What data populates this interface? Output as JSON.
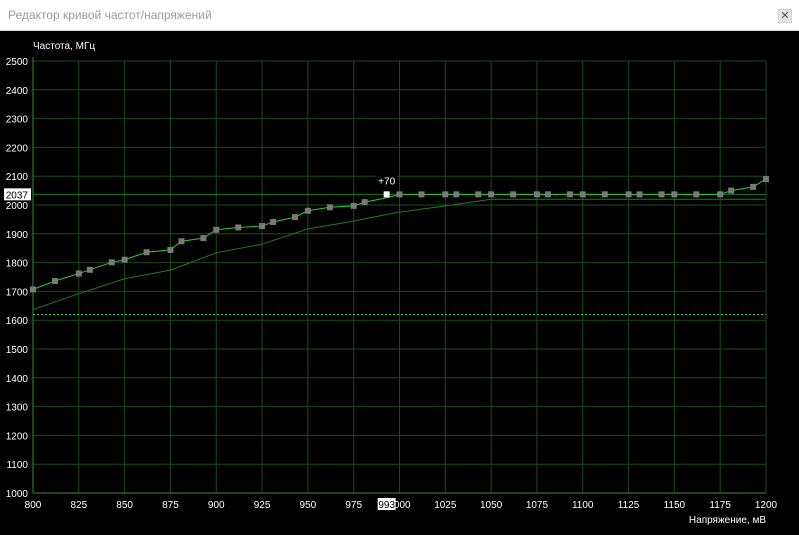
{
  "window": {
    "title": "Редактор кривой частот/напряжений",
    "close_glyph": "✕"
  },
  "chart_data": {
    "type": "line",
    "ylabel": "Частота, МГц",
    "xlabel": "Напряжение, мВ",
    "xlim": [
      800,
      1200
    ],
    "ylim": [
      1000,
      2500
    ],
    "xticks": [
      800,
      825,
      850,
      875,
      900,
      925,
      950,
      975,
      1000,
      1025,
      1050,
      1075,
      1100,
      1125,
      1150,
      1175,
      1200
    ],
    "yticks": [
      1000,
      1100,
      1200,
      1300,
      1400,
      1500,
      1600,
      1700,
      1800,
      1900,
      2000,
      2100,
      2200,
      2300,
      2400,
      2500
    ],
    "grid": true,
    "colors": {
      "background": "#000000",
      "grid": "#1c4a1c",
      "axis": "#3a8a3a",
      "curve": "#2ecc2e",
      "baseline_curve": "#1f7a1f",
      "reference_line": "#33cc33",
      "point": "#7a7a7a",
      "selected_point": "#ffffff",
      "label_text": "#ffffff"
    },
    "series": [
      {
        "role": "curve",
        "x": [
          800,
          812,
          825,
          831,
          843,
          850,
          862,
          875,
          881,
          893,
          900,
          912,
          925,
          931,
          943,
          950,
          962,
          975,
          981,
          993,
          1000,
          1012,
          1025,
          1031,
          1043,
          1050,
          1062,
          1075,
          1081,
          1093,
          1100,
          1112,
          1125,
          1131,
          1143,
          1150,
          1162,
          1175,
          1181,
          1193,
          1200
        ],
        "y": [
          1707,
          1736,
          1762,
          1775,
          1801,
          1810,
          1836,
          1844,
          1874,
          1885,
          1914,
          1922,
          1927,
          1941,
          1958,
          1980,
          1992,
          1997,
          2010,
          2025,
          2037,
          2037,
          2037,
          2037,
          2037,
          2037,
          2037,
          2037,
          2037,
          2037,
          2037,
          2037,
          2037,
          2037,
          2037,
          2037,
          2037,
          2037,
          2050,
          2063,
          2090
        ],
        "markers": [
          true,
          true,
          true,
          true,
          true,
          true,
          true,
          true,
          true,
          true,
          true,
          true,
          true,
          true,
          true,
          true,
          true,
          true,
          true,
          false,
          true,
          true,
          true,
          true,
          true,
          true,
          true,
          true,
          true,
          true,
          true,
          true,
          true,
          true,
          true,
          true,
          true,
          true,
          true,
          true,
          true
        ]
      },
      {
        "role": "baseline_curve",
        "x": [
          800,
          825,
          850,
          875,
          900,
          925,
          950,
          975,
          993,
          1000,
          1025,
          1050,
          1075,
          1100,
          1125,
          1150,
          1175,
          1200
        ],
        "y": [
          1637,
          1692,
          1744,
          1774,
          1834,
          1864,
          1917,
          1944,
          1967,
          1975,
          1997,
          2020,
          2020,
          2020,
          2020,
          2020,
          2020,
          2020
        ]
      }
    ],
    "reference_line_y": 1620,
    "current_frequency_label": "2037",
    "current_voltage_label": "993",
    "selected_point": {
      "x": 993,
      "y": 2037,
      "offset_label": "+70"
    }
  }
}
